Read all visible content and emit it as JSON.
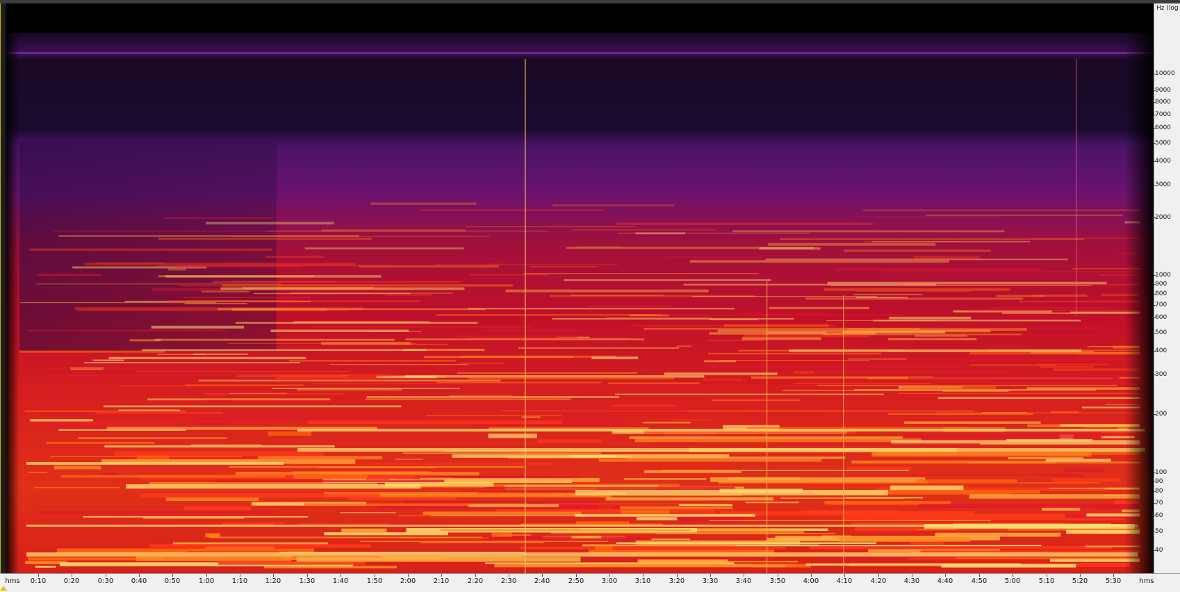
{
  "frequency_axis": {
    "title": "Hz (log",
    "ticks": [
      "10000",
      "9000",
      "8000",
      "7000",
      "6000",
      "5000",
      "4000",
      "3000",
      "2000",
      "1000",
      "900",
      "800",
      "700",
      "600",
      "500",
      "400",
      "300",
      "200",
      "100",
      "90",
      "80",
      "70",
      "60",
      "50",
      "40"
    ]
  },
  "time_axis": {
    "start_label": "hms",
    "end_label": "hms",
    "ticks": [
      "0:10",
      "0:20",
      "0:30",
      "0:40",
      "0:50",
      "1:00",
      "1:10",
      "1:20",
      "1:30",
      "1:40",
      "1:50",
      "2:00",
      "2:10",
      "2:20",
      "2:30",
      "2:40",
      "2:50",
      "3:00",
      "3:10",
      "3:20",
      "3:30",
      "3:40",
      "3:50",
      "4:00",
      "4:10",
      "4:20",
      "4:30",
      "4:40",
      "4:50",
      "5:00",
      "5:10",
      "5:20",
      "5:30"
    ]
  },
  "colors": {
    "background": "#000000",
    "low": "#1a0a2e",
    "mid_purple": "#5a1470",
    "red": "#d0102a",
    "orange": "#ff6a10",
    "yellow": "#ffe070",
    "axis_bg": "#f0f0f0"
  }
}
